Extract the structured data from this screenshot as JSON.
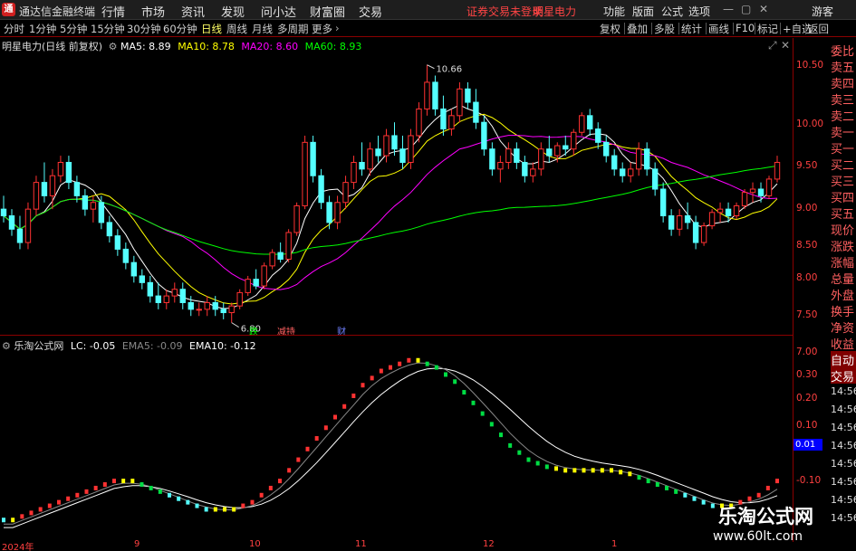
{
  "app": {
    "title": "通达信金融终端",
    "status_notice": "证券交易未登录",
    "stock_title": "明星电力"
  },
  "menu": [
    "行情",
    "市场",
    "资讯",
    "发现",
    "问小达",
    "财富圈",
    "交易"
  ],
  "window_buttons": [
    "功能",
    "版面",
    "公式",
    "选项",
    "游客"
  ],
  "toolbar": {
    "periods": [
      "分时",
      "1分钟",
      "5分钟",
      "15分钟",
      "30分钟",
      "60分钟",
      "日线",
      "周线",
      "月线",
      "多周期",
      "更多"
    ],
    "active_period": "日线",
    "right": [
      "复权",
      "叠加",
      "多股",
      "统计",
      "画线",
      "F10",
      "标记",
      "+自选",
      "返回"
    ]
  },
  "ma_legend": {
    "stock": "明星电力(日线 前复权)",
    "items": [
      {
        "label": "MA5: 8.89",
        "color": "#ffffff"
      },
      {
        "label": "MA10: 8.78",
        "color": "#ffff00"
      },
      {
        "label": "MA20: 8.60",
        "color": "#ff00ff"
      },
      {
        "label": "MA60: 8.93",
        "color": "#00ff00"
      }
    ]
  },
  "indicator_legend": {
    "name": "乐淘公式网",
    "items": [
      {
        "label": "LC: -0.05",
        "color": "#ffffff"
      },
      {
        "label": "EMA5: -0.09",
        "color": "#888888"
      },
      {
        "label": "EMA10: -0.12",
        "color": "#ffffff"
      }
    ]
  },
  "annotations": {
    "high": "10.66",
    "low": "6.80",
    "events": [
      "跌",
      "减持",
      "财"
    ]
  },
  "y_axis_main": [
    "10.50",
    "10.00",
    "9.50",
    "9.00",
    "8.50",
    "8.00",
    "7.50",
    "7.00"
  ],
  "y_axis_ind": [
    "0.30",
    "0.20",
    "0.10",
    "0.01",
    "-0.10"
  ],
  "ind_value": "0.01",
  "side_panel": [
    "委比",
    "卖五",
    "卖四",
    "卖三",
    "卖二",
    "卖一",
    "买一",
    "买二",
    "买三",
    "买四",
    "买五",
    "现价",
    "涨跌",
    "涨幅",
    "总量",
    "外盘",
    "换手",
    "净资",
    "收益",
    "自动",
    "交易",
    "14:56",
    "14:56",
    "14:56",
    "14:56",
    "14:56",
    "14:56",
    "14:56",
    "14:56"
  ],
  "x_axis": [
    "2024年",
    "9",
    "10",
    "11",
    "12",
    "1"
  ],
  "watermark": {
    "title": "乐淘公式网",
    "url": "www.60lt.com"
  },
  "chart_data": [
    {
      "type": "candlestick",
      "title": "明星电力(日线 前复权)",
      "ylim": [
        6.7,
        10.9
      ],
      "candles": [
        [
          8.5,
          8.7,
          8.3,
          8.4
        ],
        [
          8.4,
          8.5,
          8.1,
          8.2
        ],
        [
          8.2,
          8.4,
          7.9,
          8.0
        ],
        [
          8.0,
          8.6,
          7.9,
          8.5
        ],
        [
          8.5,
          9.0,
          8.4,
          8.9
        ],
        [
          8.9,
          9.2,
          8.6,
          8.7
        ],
        [
          8.7,
          9.1,
          8.5,
          9.0
        ],
        [
          9.0,
          9.3,
          8.9,
          9.2
        ],
        [
          9.2,
          9.3,
          8.8,
          8.9
        ],
        [
          8.9,
          9.0,
          8.6,
          8.7
        ],
        [
          8.7,
          8.8,
          8.4,
          8.5
        ],
        [
          8.5,
          8.7,
          8.3,
          8.6
        ],
        [
          8.6,
          8.7,
          8.2,
          8.3
        ],
        [
          8.3,
          8.4,
          8.0,
          8.1
        ],
        [
          8.1,
          8.2,
          7.8,
          7.9
        ],
        [
          7.9,
          8.0,
          7.6,
          7.7
        ],
        [
          7.7,
          7.8,
          7.4,
          7.5
        ],
        [
          7.5,
          7.6,
          7.3,
          7.4
        ],
        [
          7.4,
          7.5,
          7.1,
          7.2
        ],
        [
          7.2,
          7.4,
          7.0,
          7.1
        ],
        [
          7.1,
          7.3,
          7.0,
          7.2
        ],
        [
          7.2,
          7.4,
          7.1,
          7.3
        ],
        [
          7.3,
          7.4,
          7.0,
          7.1
        ],
        [
          7.1,
          7.2,
          6.9,
          7.0
        ],
        [
          7.0,
          7.1,
          6.9,
          7.0
        ],
        [
          7.0,
          7.2,
          6.9,
          7.1
        ],
        [
          7.1,
          7.2,
          6.9,
          7.0
        ],
        [
          7.0,
          7.1,
          6.85,
          6.95
        ],
        [
          6.95,
          7.1,
          6.8,
          7.05
        ],
        [
          7.05,
          7.3,
          7.0,
          7.25
        ],
        [
          7.25,
          7.5,
          7.2,
          7.45
        ],
        [
          7.45,
          7.6,
          7.3,
          7.35
        ],
        [
          7.35,
          7.7,
          7.3,
          7.65
        ],
        [
          7.65,
          7.9,
          7.6,
          7.85
        ],
        [
          7.85,
          8.0,
          7.7,
          7.75
        ],
        [
          7.75,
          8.2,
          7.7,
          8.15
        ],
        [
          8.15,
          8.6,
          8.1,
          8.55
        ],
        [
          8.55,
          9.6,
          8.5,
          9.5
        ],
        [
          9.5,
          9.6,
          8.9,
          9.0
        ],
        [
          9.0,
          9.1,
          8.5,
          8.6
        ],
        [
          8.6,
          8.7,
          8.2,
          8.3
        ],
        [
          8.3,
          8.7,
          8.2,
          8.6
        ],
        [
          8.6,
          9.0,
          8.5,
          8.9
        ],
        [
          8.9,
          9.3,
          8.8,
          9.2
        ],
        [
          9.2,
          9.5,
          9.0,
          9.1
        ],
        [
          9.1,
          9.5,
          9.0,
          9.4
        ],
        [
          9.4,
          9.6,
          9.2,
          9.3
        ],
        [
          9.3,
          9.7,
          9.2,
          9.6
        ],
        [
          9.6,
          9.8,
          9.3,
          9.4
        ],
        [
          9.4,
          9.6,
          9.1,
          9.2
        ],
        [
          9.2,
          9.7,
          9.1,
          9.6
        ],
        [
          9.6,
          10.1,
          9.5,
          10.0
        ],
        [
          10.0,
          10.66,
          9.9,
          10.4
        ],
        [
          10.4,
          10.5,
          9.9,
          10.0
        ],
        [
          10.0,
          10.2,
          9.6,
          9.7
        ],
        [
          9.7,
          10.0,
          9.6,
          9.9
        ],
        [
          9.9,
          10.4,
          9.8,
          10.3
        ],
        [
          10.3,
          10.4,
          10.0,
          10.1
        ],
        [
          10.1,
          10.3,
          9.7,
          9.8
        ],
        [
          9.8,
          9.9,
          9.3,
          9.4
        ],
        [
          9.4,
          9.5,
          9.0,
          9.1
        ],
        [
          9.1,
          9.3,
          8.9,
          9.2
        ],
        [
          9.2,
          9.5,
          9.1,
          9.4
        ],
        [
          9.4,
          9.5,
          9.1,
          9.2
        ],
        [
          9.2,
          9.3,
          8.9,
          9.0
        ],
        [
          9.0,
          9.2,
          8.9,
          9.1
        ],
        [
          9.1,
          9.5,
          9.0,
          9.4
        ],
        [
          9.4,
          9.6,
          9.2,
          9.3
        ],
        [
          9.3,
          9.5,
          9.2,
          9.45
        ],
        [
          9.45,
          9.6,
          9.3,
          9.4
        ],
        [
          9.4,
          9.7,
          9.3,
          9.65
        ],
        [
          9.65,
          9.95,
          9.6,
          9.9
        ],
        [
          9.9,
          10.0,
          9.6,
          9.7
        ],
        [
          9.7,
          9.8,
          9.4,
          9.5
        ],
        [
          9.5,
          9.6,
          9.2,
          9.3
        ],
        [
          9.3,
          9.4,
          9.0,
          9.1
        ],
        [
          9.1,
          9.2,
          8.9,
          9.0
        ],
        [
          9.0,
          9.2,
          8.9,
          9.1
        ],
        [
          9.1,
          9.5,
          9.0,
          9.4
        ],
        [
          9.4,
          9.5,
          9.0,
          9.1
        ],
        [
          9.1,
          9.2,
          8.7,
          8.8
        ],
        [
          8.8,
          8.9,
          8.3,
          8.4
        ],
        [
          8.4,
          8.5,
          8.1,
          8.2
        ],
        [
          8.2,
          8.5,
          8.1,
          8.4
        ],
        [
          8.4,
          8.6,
          8.2,
          8.3
        ],
        [
          8.3,
          8.4,
          7.9,
          8.0
        ],
        [
          8.0,
          8.3,
          7.95,
          8.25
        ],
        [
          8.25,
          8.5,
          8.2,
          8.45
        ],
        [
          8.45,
          8.6,
          8.3,
          8.5
        ],
        [
          8.5,
          8.6,
          8.3,
          8.4
        ],
        [
          8.4,
          8.6,
          8.35,
          8.55
        ],
        [
          8.55,
          8.8,
          8.5,
          8.75
        ],
        [
          8.75,
          8.9,
          8.6,
          8.8
        ],
        [
          8.8,
          8.9,
          8.6,
          8.7
        ],
        [
          8.7,
          9.0,
          8.65,
          8.95
        ],
        [
          8.95,
          9.3,
          8.9,
          9.2
        ]
      ],
      "series": [
        {
          "name": "MA5",
          "color": "#ffffff"
        },
        {
          "name": "MA10",
          "color": "#ffff00"
        },
        {
          "name": "MA20",
          "color": "#ff00ff"
        },
        {
          "name": "MA60",
          "color": "#00ff00"
        }
      ]
    },
    {
      "type": "line",
      "title": "乐淘公式网",
      "ylim": [
        -0.14,
        0.37
      ],
      "lc": [
        -0.11,
        -0.11,
        -0.1,
        -0.09,
        -0.08,
        -0.07,
        -0.06,
        -0.05,
        -0.04,
        -0.03,
        -0.02,
        -0.01,
        0.0,
        0.0,
        0.0,
        -0.01,
        -0.02,
        -0.03,
        -0.04,
        -0.05,
        -0.06,
        -0.07,
        -0.08,
        -0.08,
        -0.08,
        -0.08,
        -0.07,
        -0.06,
        -0.04,
        -0.02,
        0.0,
        0.03,
        0.06,
        0.09,
        0.12,
        0.15,
        0.18,
        0.21,
        0.24,
        0.27,
        0.29,
        0.31,
        0.32,
        0.33,
        0.34,
        0.34,
        0.33,
        0.32,
        0.3,
        0.28,
        0.25,
        0.22,
        0.19,
        0.16,
        0.13,
        0.1,
        0.08,
        0.06,
        0.05,
        0.04,
        0.035,
        0.03,
        0.03,
        0.03,
        0.03,
        0.03,
        0.03,
        0.025,
        0.02,
        0.01,
        0.0,
        -0.01,
        -0.02,
        -0.03,
        -0.04,
        -0.05,
        -0.06,
        -0.07,
        -0.07,
        -0.07,
        -0.06,
        -0.05,
        -0.04,
        -0.02,
        0.0
      ],
      "ema5": [
        -0.12,
        -0.12,
        -0.11,
        -0.1,
        -0.09,
        -0.08,
        -0.07,
        -0.06,
        -0.05,
        -0.04,
        -0.03,
        -0.02,
        -0.01,
        -0.005,
        -0.005,
        -0.008,
        -0.015,
        -0.025,
        -0.035,
        -0.045,
        -0.055,
        -0.065,
        -0.072,
        -0.078,
        -0.08,
        -0.08,
        -0.075,
        -0.068,
        -0.055,
        -0.038,
        -0.018,
        0.008,
        0.036,
        0.066,
        0.096,
        0.126,
        0.156,
        0.186,
        0.215,
        0.245,
        0.27,
        0.29,
        0.305,
        0.318,
        0.328,
        0.334,
        0.333,
        0.326,
        0.315,
        0.298,
        0.276,
        0.25,
        0.222,
        0.194,
        0.165,
        0.136,
        0.111,
        0.088,
        0.07,
        0.056,
        0.046,
        0.039,
        0.035,
        0.033,
        0.032,
        0.031,
        0.031,
        0.028,
        0.024,
        0.017,
        0.008,
        -0.002,
        -0.012,
        -0.022,
        -0.032,
        -0.042,
        -0.052,
        -0.061,
        -0.066,
        -0.068,
        -0.064,
        -0.058,
        -0.05,
        -0.038,
        -0.022
      ],
      "ema10": [
        -0.13,
        -0.13,
        -0.12,
        -0.11,
        -0.1,
        -0.09,
        -0.08,
        -0.07,
        -0.06,
        -0.05,
        -0.04,
        -0.03,
        -0.02,
        -0.015,
        -0.012,
        -0.012,
        -0.015,
        -0.02,
        -0.027,
        -0.035,
        -0.043,
        -0.052,
        -0.06,
        -0.066,
        -0.071,
        -0.074,
        -0.074,
        -0.071,
        -0.064,
        -0.053,
        -0.038,
        -0.02,
        0.002,
        0.027,
        0.053,
        0.081,
        0.11,
        0.139,
        0.168,
        0.196,
        0.222,
        0.245,
        0.265,
        0.283,
        0.298,
        0.31,
        0.317,
        0.319,
        0.317,
        0.311,
        0.3,
        0.286,
        0.268,
        0.248,
        0.226,
        0.203,
        0.179,
        0.155,
        0.133,
        0.113,
        0.096,
        0.082,
        0.071,
        0.063,
        0.057,
        0.052,
        0.048,
        0.044,
        0.04,
        0.034,
        0.026,
        0.017,
        0.007,
        -0.003,
        -0.013,
        -0.023,
        -0.033,
        -0.043,
        -0.051,
        -0.057,
        -0.06,
        -0.06,
        -0.057,
        -0.05,
        -0.04
      ]
    }
  ]
}
